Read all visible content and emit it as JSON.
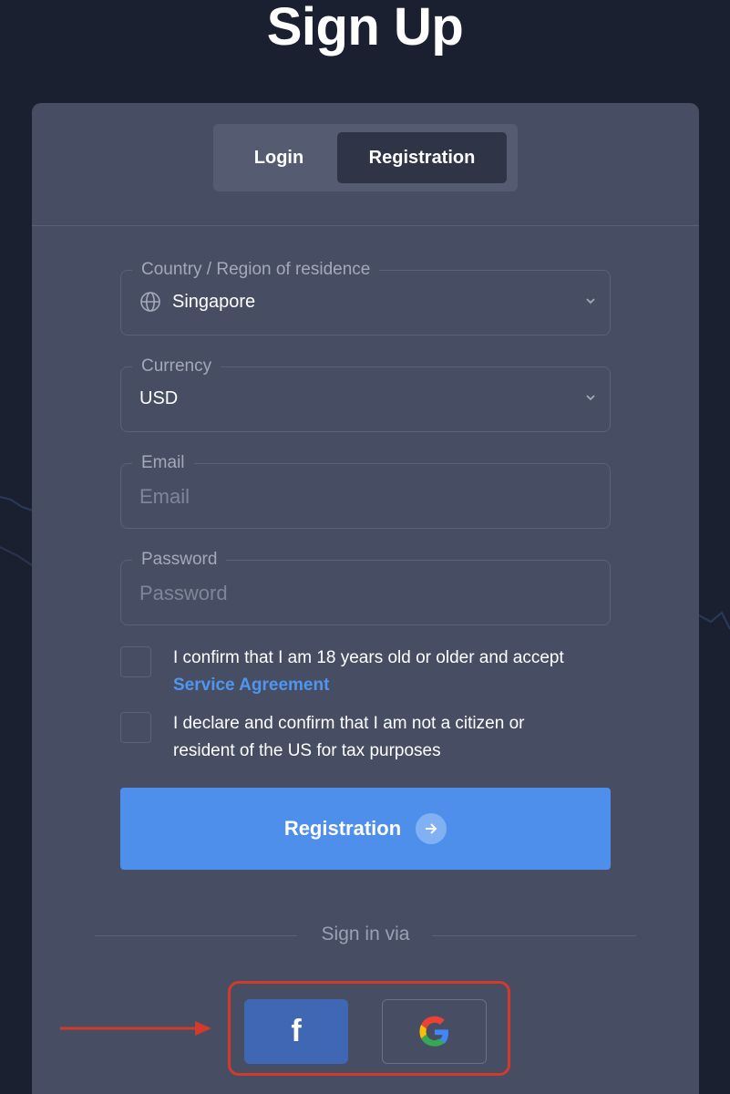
{
  "page": {
    "title": "Sign Up"
  },
  "tabs": [
    {
      "label": "Login",
      "active": false
    },
    {
      "label": "Registration",
      "active": true
    }
  ],
  "form": {
    "country": {
      "label": "Country / Region of residence",
      "value": "Singapore",
      "icon": "globe-icon"
    },
    "currency": {
      "label": "Currency",
      "value": "USD"
    },
    "email": {
      "label": "Email",
      "placeholder": "Email",
      "value": ""
    },
    "password": {
      "label": "Password",
      "placeholder": "Password",
      "value": ""
    },
    "checks": [
      {
        "text": "I confirm that I am 18 years old or older and accept",
        "link": "Service Agreement",
        "checked": false
      },
      {
        "text": "I declare and confirm that I am not a citizen or resident of the US for tax purposes",
        "checked": false
      }
    ],
    "submit_label": "Registration"
  },
  "social": {
    "heading": "Sign in via",
    "facebook_icon": "f",
    "google_icon": "google-icon"
  },
  "colors": {
    "background": "#1b2030",
    "card": "#474d63",
    "primary_button": "#4f8fec",
    "link": "#4f96f0",
    "facebook": "#3f67b3",
    "highlight": "#d23a2a"
  }
}
